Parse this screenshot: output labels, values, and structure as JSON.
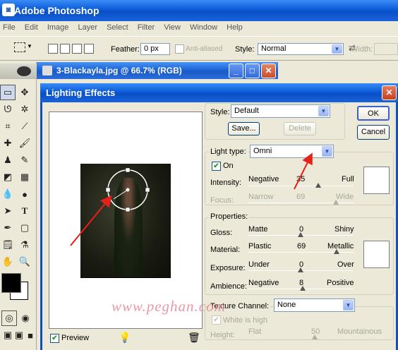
{
  "app": {
    "title": "Adobe Photoshop"
  },
  "menu": [
    "File",
    "Edit",
    "Image",
    "Layer",
    "Select",
    "Filter",
    "View",
    "Window",
    "Help"
  ],
  "options_bar": {
    "feather_label": "Feather:",
    "feather_value": "0 px",
    "anti_aliased_label": "Anti-aliased",
    "style_label": "Style:",
    "style_value": "Normal",
    "width_label": "Width:"
  },
  "document": {
    "title": "3-Blackayla.jpg @ 66.7% (RGB)"
  },
  "dialog": {
    "title": "Lighting Effects",
    "style_label": "Style:",
    "style_value": "Default",
    "save_label": "Save...",
    "delete_label": "Delete",
    "ok_label": "OK",
    "cancel_label": "Cancel",
    "light_type_label": "Light type:",
    "light_type_value": "Omni",
    "on_label": "On",
    "on_checked": true,
    "intensity": {
      "label": "Intensity:",
      "min": "Negative",
      "max": "Full",
      "value": "35"
    },
    "focus": {
      "label": "Focus:",
      "min": "Narrow",
      "max": "Wide",
      "value": "69"
    },
    "properties_label": "Properties:",
    "gloss": {
      "label": "Gloss:",
      "min": "Matte",
      "max": "Shiny",
      "value": "0"
    },
    "material": {
      "label": "Material:",
      "min": "Plastic",
      "max": "Metallic",
      "value": "69"
    },
    "exposure": {
      "label": "Exposure:",
      "min": "Under",
      "max": "Over",
      "value": "0"
    },
    "ambience": {
      "label": "Ambience:",
      "min": "Negative",
      "max": "Positive",
      "value": "8"
    },
    "texture_channel_label": "Texture Channel:",
    "texture_channel_value": "None",
    "white_is_high_label": "White is high",
    "height": {
      "label": "Height:",
      "min": "Flat",
      "max": "Mountainous",
      "value": "50"
    },
    "preview_label": "Preview",
    "preview_checked": true
  },
  "watermark": "www.peghan.com",
  "colors": {
    "accent": "#0a4fc4",
    "arrow": "#e8201a",
    "dialog_bg": "#ece9d8"
  }
}
